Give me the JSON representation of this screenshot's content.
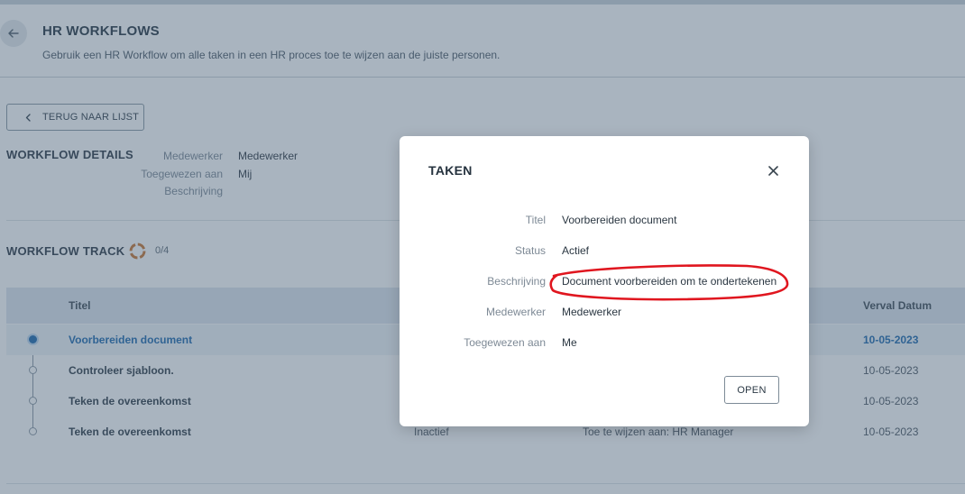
{
  "header": {
    "title": "HR WORKFLOWS",
    "subtitle": "Gebruik een HR Workflow om alle taken in een HR proces toe te wijzen aan de juiste personen."
  },
  "back_button": {
    "label": "TERUG NAAR LIJST"
  },
  "details": {
    "title": "WORKFLOW DETAILS",
    "fields": [
      {
        "label": "Medewerker",
        "value": "Medewerker"
      },
      {
        "label": "Toegewezen aan",
        "value": "Mij"
      },
      {
        "label": "Beschrijving",
        "value": ""
      }
    ]
  },
  "track": {
    "title": "WORKFLOW TRACK",
    "progress_text": "0/4",
    "progress_fraction": 0
  },
  "table": {
    "columns": {
      "titel": "Titel",
      "verval_datum": "Verval Datum"
    },
    "rows": [
      {
        "titel": "Voorbereiden document",
        "status": "",
        "toegewezen": "",
        "verval_datum": "10-05-2023",
        "active": true
      },
      {
        "titel": "Controleer sjabloon.",
        "status": "",
        "toegewezen": "",
        "verval_datum": "10-05-2023",
        "active": false
      },
      {
        "titel": "Teken de overeenkomst",
        "status": "",
        "toegewezen": "",
        "verval_datum": "10-05-2023",
        "active": false
      },
      {
        "titel": "Teken de overeenkomst",
        "status": "Inactief",
        "toegewezen": "Toe te wijzen aan: HR Manager",
        "verval_datum": "10-05-2023",
        "active": false
      }
    ]
  },
  "modal": {
    "title": "TAKEN",
    "fields": [
      {
        "label": "Titel",
        "value": "Voorbereiden document"
      },
      {
        "label": "Status",
        "value": "Actief"
      },
      {
        "label": "Beschrijving",
        "value": "Document voorbereiden om te ondertekenen"
      },
      {
        "label": "Medewerker",
        "value": "Medewerker"
      },
      {
        "label": "Toegewezen aan",
        "value": "Me"
      }
    ],
    "open_label": "OPEN"
  },
  "colors": {
    "accent": "#1a66ad",
    "annotation": "#e0161f",
    "progress_ring": "#c8732e"
  },
  "icons": {
    "back": "arrow-left-icon",
    "list_back": "chevron-left-icon",
    "close": "close-icon",
    "progress": "progress-ring-icon"
  }
}
